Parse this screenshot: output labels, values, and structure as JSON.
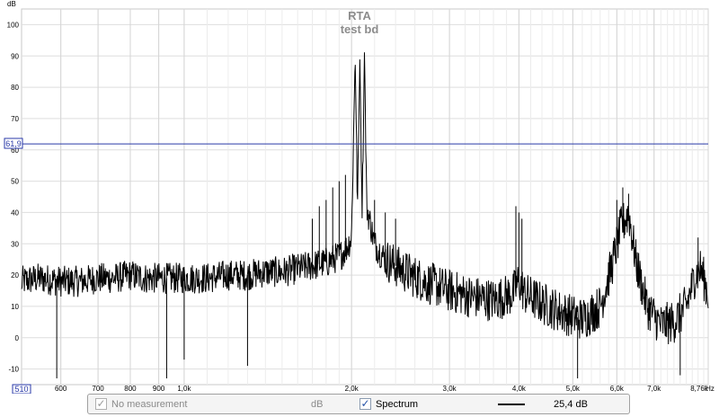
{
  "chart_data": {
    "type": "line",
    "title": "RTA",
    "subtitle": "test bd",
    "ylabel": "dB",
    "xlabel": "Hz",
    "xscale": "log",
    "xlim": [
      510,
      8760
    ],
    "ylim": [
      -15,
      105
    ],
    "y_ticks": [
      -10,
      0,
      10,
      20,
      30,
      40,
      50,
      60,
      70,
      80,
      90,
      100
    ],
    "x_ticks": [
      {
        "value": 600,
        "label": "600"
      },
      {
        "value": 700,
        "label": "700"
      },
      {
        "value": 800,
        "label": "800"
      },
      {
        "value": 900,
        "label": "900"
      },
      {
        "value": 1000,
        "label": "1,0k"
      },
      {
        "value": 2000,
        "label": "2,0k"
      },
      {
        "value": 3000,
        "label": "3,0k"
      },
      {
        "value": 4000,
        "label": "4,0k"
      },
      {
        "value": 5000,
        "label": "5,0k"
      },
      {
        "value": 6000,
        "label": "6,0k"
      },
      {
        "value": 7000,
        "label": "7,0k"
      },
      {
        "value": 8760,
        "label": "8,76k"
      }
    ],
    "x_start_label": "510",
    "marker_line": {
      "value": 61.9,
      "label": "61,9",
      "color": "#2a3aa8"
    },
    "grid": true,
    "series": [
      {
        "name": "Spectrum",
        "color": "#000000",
        "x": [
          510,
          550,
          600,
          650,
          700,
          750,
          800,
          850,
          900,
          950,
          1000,
          1100,
          1200,
          1300,
          1400,
          1500,
          1600,
          1700,
          1800,
          1900,
          1950,
          2000,
          2030,
          2050,
          2070,
          2090,
          2110,
          2130,
          2200,
          2300,
          2500,
          2700,
          3000,
          3300,
          3600,
          3900,
          4000,
          4100,
          4400,
          4800,
          5200,
          5600,
          5900,
          6100,
          6300,
          6500,
          6800,
          7200,
          7600,
          8000,
          8300,
          8500,
          8760
        ],
        "y": [
          18,
          19,
          18,
          18,
          19,
          19,
          20,
          19,
          19,
          19,
          19,
          19,
          20,
          20,
          21,
          21,
          22,
          23,
          24,
          26,
          28,
          32,
          90,
          42,
          89,
          42,
          92,
          42,
          30,
          25,
          21,
          18,
          15,
          13,
          12,
          14,
          18,
          14,
          11,
          8,
          6,
          10,
          24,
          35,
          40,
          24,
          10,
          4,
          5,
          10,
          20,
          22,
          14
        ],
        "spikes": [
          {
            "x": 1700,
            "y": 38
          },
          {
            "x": 1750,
            "y": 42
          },
          {
            "x": 1800,
            "y": 44
          },
          {
            "x": 1850,
            "y": 48
          },
          {
            "x": 1900,
            "y": 50
          },
          {
            "x": 1950,
            "y": 52
          },
          {
            "x": 2200,
            "y": 44
          },
          {
            "x": 2300,
            "y": 40
          },
          {
            "x": 2400,
            "y": 38
          },
          {
            "x": 3950,
            "y": 42
          },
          {
            "x": 4000,
            "y": 40
          },
          {
            "x": 4050,
            "y": 38
          },
          {
            "x": 6000,
            "y": 44
          },
          {
            "x": 6150,
            "y": 48
          },
          {
            "x": 6300,
            "y": 46
          },
          {
            "x": 8400,
            "y": 32
          }
        ],
        "dips": [
          {
            "x": 590,
            "y": -13
          },
          {
            "x": 930,
            "y": -13
          },
          {
            "x": 1000,
            "y": -7
          },
          {
            "x": 1300,
            "y": -9
          },
          {
            "x": 5100,
            "y": -13
          },
          {
            "x": 7800,
            "y": -12
          }
        ]
      }
    ]
  },
  "legend": {
    "no_measurement_label": "No measurement",
    "unit_label": "dB",
    "spectrum_label": "Spectrum",
    "level_value": "25,4 dB"
  }
}
